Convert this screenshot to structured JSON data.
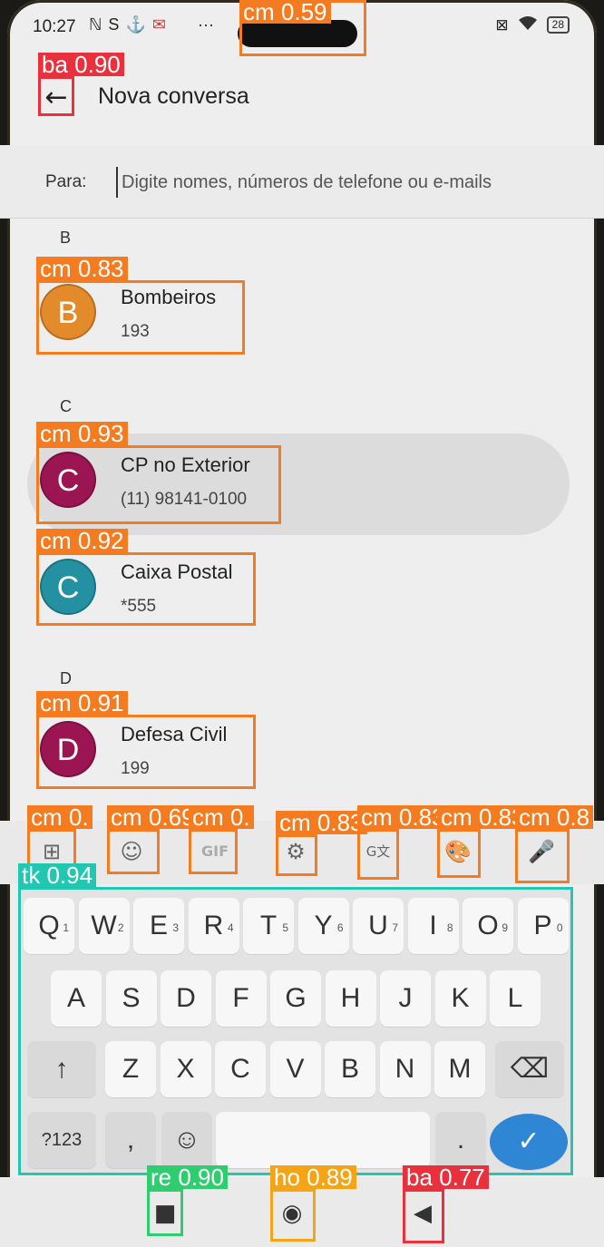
{
  "status_bar": {
    "time": "10:27",
    "left_icons": [
      "ℕ",
      "S",
      "⚓",
      "✉"
    ],
    "overflow": "···",
    "right_icons": [
      "⊠",
      "wifi"
    ],
    "battery": "28"
  },
  "header": {
    "back_glyph": "←",
    "title": "Nova conversa"
  },
  "recipient": {
    "label": "Para:",
    "placeholder": "Digite nomes, números de telefone ou e-mails"
  },
  "sections": [
    {
      "letter": "B",
      "contacts": [
        {
          "initial": "B",
          "name": "Bombeiros",
          "number": "193",
          "color": "#e38b2b"
        }
      ]
    },
    {
      "letter": "C",
      "contacts": [
        {
          "initial": "C",
          "name": "CP no Exterior",
          "number": "(11) 98141-0100",
          "color": "#9b1552"
        },
        {
          "initial": "C",
          "name": "Caixa Postal",
          "number": "*555",
          "color": "#2391a2"
        }
      ]
    },
    {
      "letter": "D",
      "contacts": [
        {
          "initial": "D",
          "name": "Defesa Civil",
          "number": "199",
          "color": "#9b1552"
        }
      ]
    }
  ],
  "keyboard_toolbar": [
    {
      "name": "apps-grid-icon",
      "glyph": "⊞"
    },
    {
      "name": "sticker-icon",
      "glyph": "☺"
    },
    {
      "name": "gif-icon",
      "glyph": "GIF"
    },
    {
      "name": "settings-icon",
      "glyph": "⚙"
    },
    {
      "name": "translate-icon",
      "glyph": "G文"
    },
    {
      "name": "theme-palette-icon",
      "glyph": "🎨"
    },
    {
      "name": "microphone-icon",
      "glyph": "🎤"
    }
  ],
  "keyboard": {
    "row1": [
      {
        "k": "Q",
        "h": "1"
      },
      {
        "k": "W",
        "h": "2"
      },
      {
        "k": "E",
        "h": "3"
      },
      {
        "k": "R",
        "h": "4"
      },
      {
        "k": "T",
        "h": "5"
      },
      {
        "k": "Y",
        "h": "6"
      },
      {
        "k": "U",
        "h": "7"
      },
      {
        "k": "I",
        "h": "8"
      },
      {
        "k": "O",
        "h": "9"
      },
      {
        "k": "P",
        "h": "0"
      }
    ],
    "row2": [
      "A",
      "S",
      "D",
      "F",
      "G",
      "H",
      "J",
      "K",
      "L"
    ],
    "row3": [
      "Z",
      "X",
      "C",
      "V",
      "B",
      "N",
      "M"
    ],
    "shift": "↑",
    "backspace": "⌫",
    "symbols": "?123",
    "comma": ",",
    "emoji": "☺",
    "period": ".",
    "enter": "✓"
  },
  "nav_bar": {
    "recents": "■",
    "home": "◉",
    "back": "◀"
  },
  "detections": [
    {
      "label": "cm 0.59",
      "color": "orange"
    },
    {
      "label": "ba 0.90",
      "color": "red"
    },
    {
      "label": "cm 0.83",
      "color": "orange"
    },
    {
      "label": "cm 0.93",
      "color": "orange"
    },
    {
      "label": "cm 0.92",
      "color": "orange"
    },
    {
      "label": "cm 0.91",
      "color": "orange"
    },
    {
      "label": "cm 0.",
      "color": "orange"
    },
    {
      "label": "cm 0.69",
      "color": "orange"
    },
    {
      "label": "cm 0.",
      "color": "orange"
    },
    {
      "label": "cm 0.83",
      "color": "orange"
    },
    {
      "label": "cm 0.8",
      "color": "orange"
    },
    {
      "label": "tk 0.94",
      "color": "teal"
    },
    {
      "label": "re 0.90",
      "color": "green"
    },
    {
      "label": "ho 0.89",
      "color": "yellow"
    },
    {
      "label": "ba 0.77",
      "color": "red"
    }
  ]
}
